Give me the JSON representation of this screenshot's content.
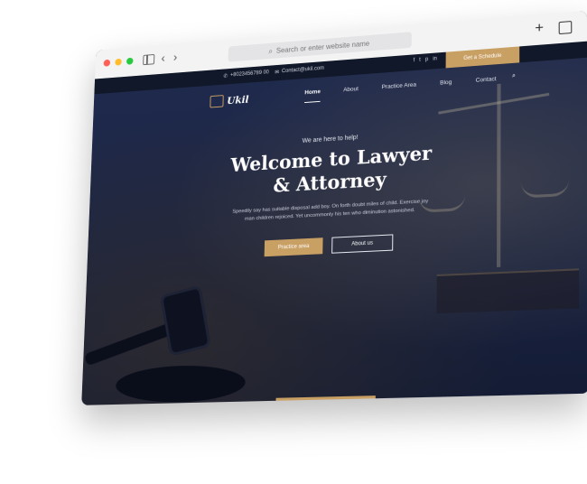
{
  "browser": {
    "url_placeholder": "Search or enter website name",
    "nav_back": "‹",
    "nav_forward": "›",
    "new_tab": "+"
  },
  "topbar": {
    "phone": "+8023456789 00",
    "email": "Contact@ukil.com",
    "socials": [
      "f",
      "t",
      "p",
      "in"
    ],
    "schedule_label": "Get a Schedule"
  },
  "header": {
    "logo_text": "Ukil",
    "menu": [
      "Home",
      "About",
      "Practice Area",
      "Blog",
      "Contact"
    ],
    "active_index": 0
  },
  "hero": {
    "kicker": "We are here to help!",
    "title_line1": "Welcome to Lawyer",
    "title_line2": "& Attorney",
    "description": "Speedily say has suitable disposal add boy. On forth doubt miles of child. Exercise joy man children rejoiced. Yet uncommonly his ten who diminution astonished.",
    "cta_primary": "Practice area",
    "cta_secondary": "About us"
  },
  "colors": {
    "accent": "#c9a064",
    "navy": "#1f2a4d",
    "topbar_bg": "#111829"
  }
}
